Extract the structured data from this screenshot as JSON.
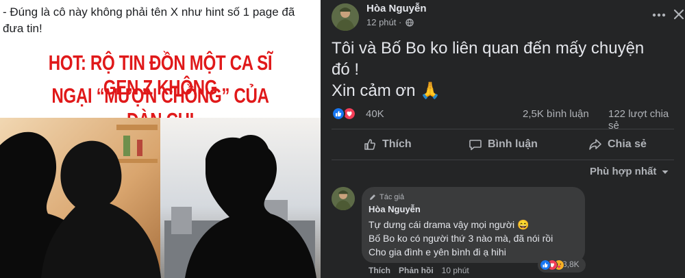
{
  "left_post": {
    "caption": "- Đúng là cô này không phải tên X như hint số 1 page đã đưa tin!",
    "banner_line_1": "HOT: RỘ TIN ĐỒN MỘT CA SĨ GEN Z KHÔNG",
    "banner_line_2": "NGẠI “MƯỢN CHỒNG” CỦA ĐÀN CHỊ",
    "banner_color": "#e0191a"
  },
  "post": {
    "author": "Hòa Nguyễn",
    "time": "12 phút ·",
    "privacy_icon": "globe-icon",
    "lines": [
      "Tôi và Bố Bo ko liên quan đến mấy chuyện",
      "đó !",
      "Xin cảm ơn 🙏"
    ],
    "reaction_count": "40K",
    "comment_count": "2,5K bình luận",
    "share_count": "122 lượt chia sẻ"
  },
  "actions": {
    "like": "Thích",
    "comment": "Bình luận",
    "share": "Chia sẻ"
  },
  "sort": {
    "label": "Phù hợp nhất"
  },
  "comment": {
    "badge": "Tác giả",
    "author": "Hòa Nguyễn",
    "lines": [
      "Tự dưng cái drama vậy mọi người 😄",
      "Bố Bo ko có người thứ 3 nào mà, đã nói rồi",
      "Cho gia đình e yên bình đi ạ hihi"
    ],
    "reaction_count": "3,8K",
    "like": "Thích",
    "reply": "Phản hồi",
    "time": "10 phút"
  },
  "colors": {
    "panel_bg": "#242526",
    "bubble_bg": "#3a3b3c",
    "text_primary": "#e4e6eb",
    "text_secondary": "#b0b3b8",
    "like_blue": "#1877f2",
    "love_red": "#f33e58",
    "haha_yellow": "#f7b125"
  }
}
